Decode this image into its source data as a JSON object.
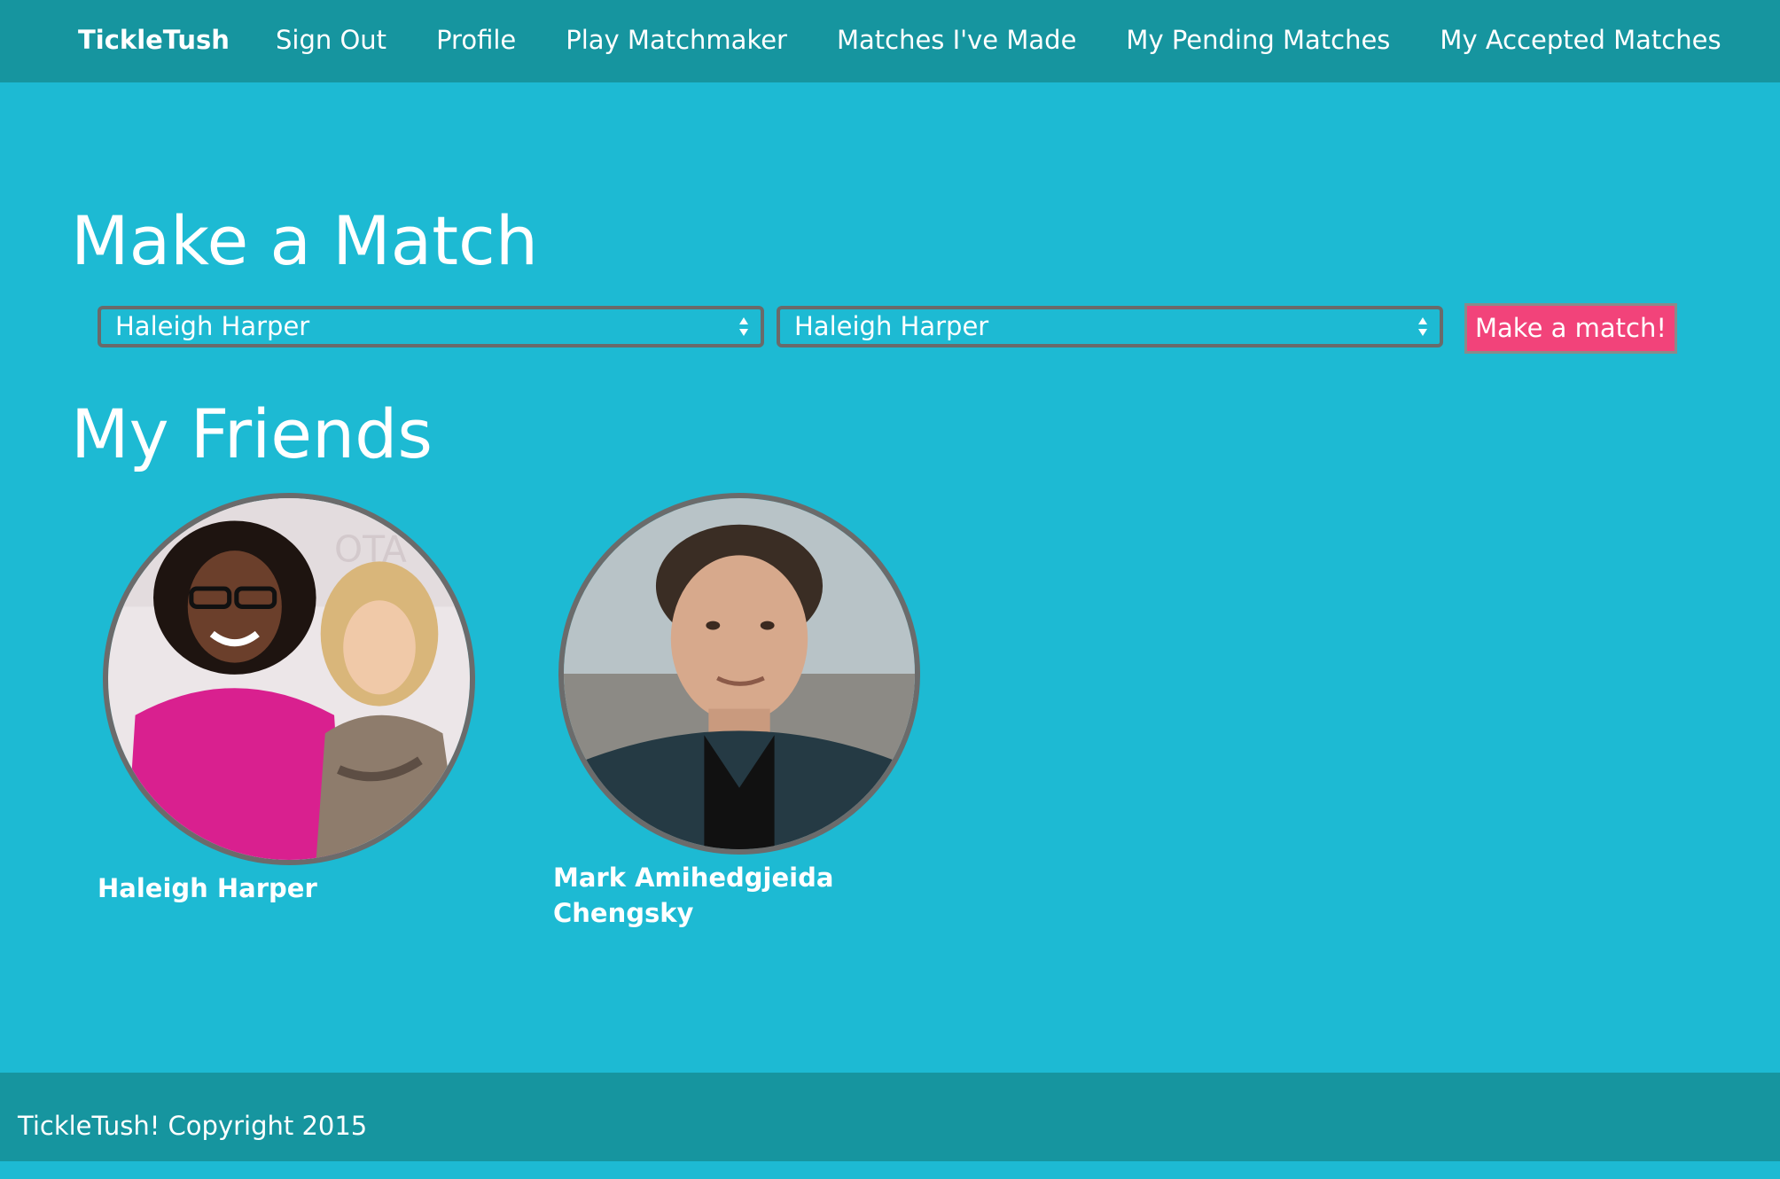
{
  "nav": {
    "brand": "TickleTush",
    "links": [
      "Sign Out",
      "Profile",
      "Play Matchmaker",
      "Matches I've Made",
      "My Pending Matches",
      "My Accepted Matches"
    ]
  },
  "make_match": {
    "title": "Make a Match",
    "select_a_value": "Haleigh Harper",
    "select_b_value": "Haleigh Harper",
    "button_label": "Make a match!"
  },
  "friends": {
    "title": "My Friends",
    "items": [
      {
        "name": "Haleigh Harper",
        "photo_icon": "avatar-photo-two-women"
      },
      {
        "name": "Mark Amihedgjeida Chengsky",
        "photo_icon": "avatar-photo-man"
      }
    ]
  },
  "footer": {
    "copyright": "TickleTush! Copyright 2015"
  },
  "colors": {
    "background": "#1dbad3",
    "navbar": "#16959f",
    "accent_button": "#f2437a",
    "avatar_border": "#6b6b6b"
  }
}
